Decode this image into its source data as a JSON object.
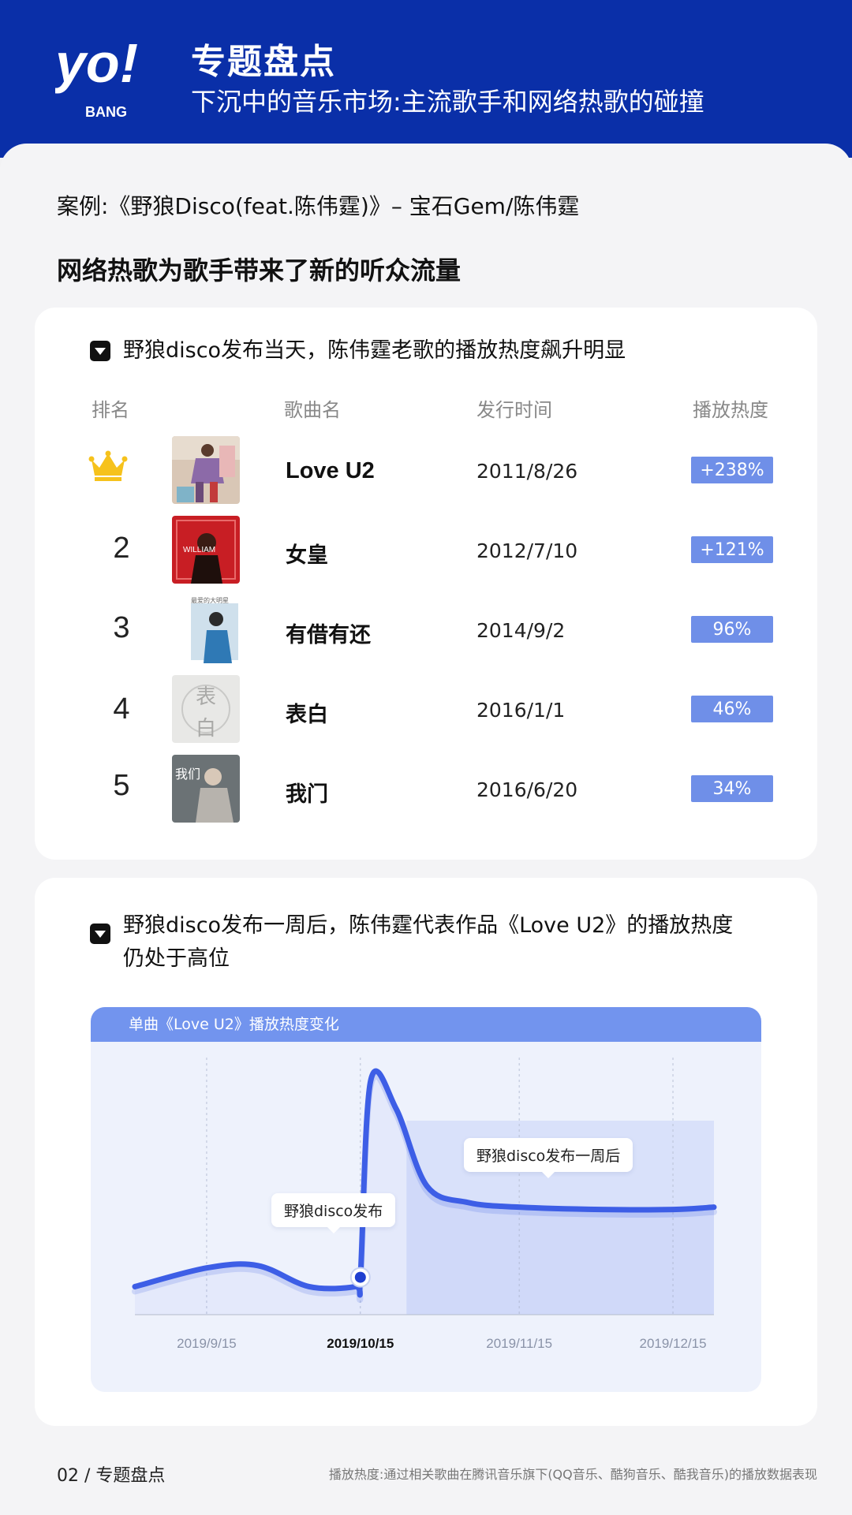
{
  "header": {
    "logo_text": "yo!",
    "logo_subtext": "BANG",
    "title": "专题盘点",
    "subtitle": "下沉中的音乐市场:主流歌手和网络热歌的碰撞"
  },
  "case_line": "案例:《野狼Disco(feat.陈伟霆)》– 宝石Gem/陈伟霆",
  "section_heading": "网络热歌为歌手带来了新的听众流量",
  "card1": {
    "title": "野狼disco发布当天，陈伟霆老歌的播放热度飙升明显",
    "columns": [
      "排名",
      "歌曲名",
      "发行时间",
      "播放热度"
    ],
    "rows": [
      {
        "rank": "1",
        "rank_icon": "crown-icon",
        "name": "Love U2",
        "date": "2011/8/26",
        "heat": "+238%"
      },
      {
        "rank": "2",
        "name": "女皇",
        "date": "2012/7/10",
        "heat": "+121%"
      },
      {
        "rank": "3",
        "name": "有借有还",
        "date": "2014/9/2",
        "heat": "96%"
      },
      {
        "rank": "4",
        "name": "表白",
        "date": "2016/1/1",
        "heat": "46%"
      },
      {
        "rank": "5",
        "name": "我门",
        "date": "2016/6/20",
        "heat": "34%"
      }
    ],
    "covers": {
      "row3_text": "最爱的大明星",
      "row4_big": "表",
      "row4_big2": "白",
      "row5_text": "我们"
    }
  },
  "card2": {
    "title_line1": "野狼disco发布一周后，陈伟霆代表作品《Love U2》的播放热度",
    "title_line2": "仍处于高位"
  },
  "chart_data": {
    "type": "line",
    "title": "单曲《Love U2》播放热度变化",
    "xlabel": "",
    "ylabel": "",
    "x_ticks": [
      "2019/9/15",
      "2019/10/15",
      "2019/11/15",
      "2019/12/15"
    ],
    "highlighted_tick": "2019/10/15",
    "series": [
      {
        "x": [
          "2019/9/1",
          "2019/9/15",
          "2019/9/25",
          "2019/10/5",
          "2019/10/14",
          "2019/10/15",
          "2019/10/17",
          "2019/10/22",
          "2019/10/28",
          "2019/11/5",
          "2019/11/15",
          "2019/12/1",
          "2019/12/15",
          "2019/12/23"
        ],
        "values": [
          12,
          20,
          21,
          12,
          12,
          16,
          100,
          88,
          55,
          48,
          46,
          45,
          45,
          46
        ]
      }
    ],
    "ylim": [
      0,
      110
    ],
    "grid": "vertical-dashed",
    "annotations": [
      {
        "label": "野狼disco发布",
        "x": "2019/10/15"
      },
      {
        "label": "野狼disco发布一周后",
        "x": "2019/11/22"
      }
    ],
    "shaded_region": {
      "from": "2019/10/24",
      "to": "2019/12/23"
    },
    "colors": {
      "line": "#3d5ee6",
      "shade": "#d9e1fa",
      "panel": "#eef2fc"
    }
  },
  "footer": {
    "page": "02 / 专题盘点",
    "note": "播放热度:通过相关歌曲在腾讯音乐旗下(QQ音乐、酷狗音乐、酷我音乐)的播放数据表现"
  }
}
